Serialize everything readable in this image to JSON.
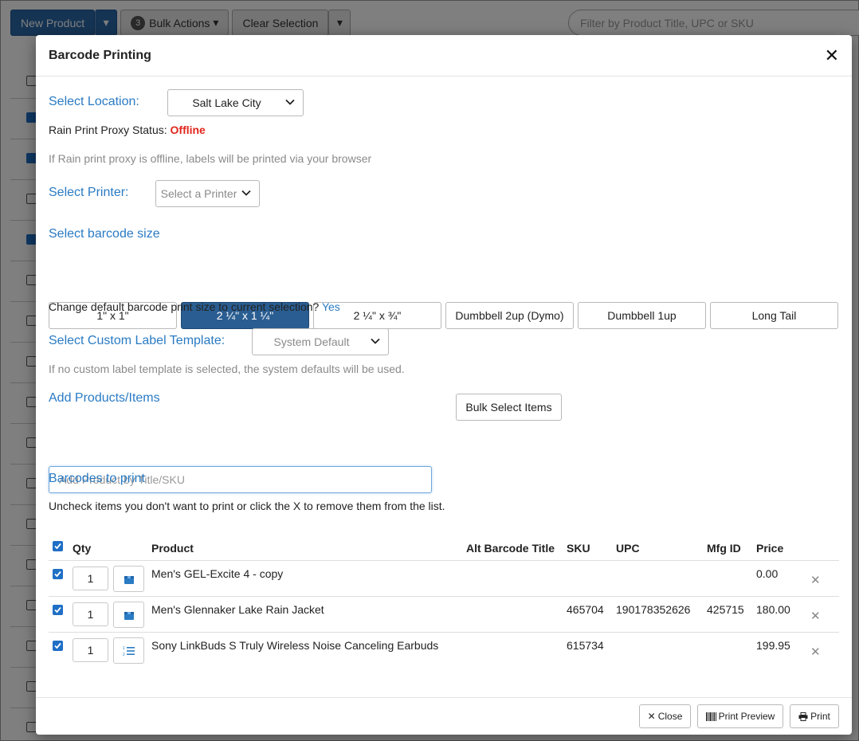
{
  "background": {
    "new_product_label": "New Product",
    "bulk_count": "3",
    "bulk_actions_label": "Bulk Actions",
    "clear_selection_label": "Clear Selection",
    "filter_placeholder": "Filter by Product Title, UPC or SKU"
  },
  "modal": {
    "title": "Barcode Printing",
    "location_label": "Select Location:",
    "location_value": "Salt Lake City",
    "proxy_status_label": "Rain Print Proxy Status:",
    "proxy_status_value": "Offline",
    "proxy_hint": "If Rain print proxy is offline, labels will be printed via your browser",
    "printer_label": "Select Printer:",
    "printer_placeholder": "Select a Printer",
    "barcode_size_label": "Select barcode size",
    "sizes": [
      "1\" x 1\"",
      "2 ¼\" x 1 ¼\"",
      "2 ¼\" x ¾\"",
      "Dumbbell 2up (Dymo)",
      "Dumbbell 1up",
      "Long Tail"
    ],
    "active_size": "2 ¼\" x 1 ¼\"",
    "change_default_text": "Change default barcode print size to current selection?",
    "change_default_link": "Yes",
    "custom_template_label": "Select Custom Label Template:",
    "custom_template_value": "System Default",
    "custom_template_hint": "If no custom label template is selected, the system defaults will be used.",
    "add_products_label": "Add Products/Items",
    "bulk_select_label": "Bulk Select Items",
    "add_product_placeholder": "Add Product by Title/SKU",
    "barcodes_to_print_label": "Barcodes to print",
    "instructions": "Uncheck items you don't want to print or click the X to remove them from the list.",
    "table": {
      "headers": {
        "qty": "Qty",
        "product": "Product",
        "alt_barcode_title": "Alt Barcode Title",
        "sku": "SKU",
        "upc": "UPC",
        "mfg_id": "Mfg ID",
        "price": "Price"
      },
      "rows": [
        {
          "qty": "1",
          "icon": "box-icon",
          "product": "Men's GEL-Excite 4 - copy",
          "sku": "",
          "upc": "",
          "mfg_id": "",
          "price": "0.00"
        },
        {
          "qty": "1",
          "icon": "box-icon",
          "product": "Men's Glennaker Lake Rain Jacket",
          "sku": "465704",
          "upc": "190178352626",
          "mfg_id": "425715",
          "price": "180.00"
        },
        {
          "qty": "1",
          "icon": "numbered-list-icon",
          "product": "Sony LinkBuds S Truly Wireless Noise Canceling Earbuds",
          "sku": "615734",
          "upc": "",
          "mfg_id": "",
          "price": "199.95"
        }
      ]
    },
    "footer": {
      "close_label": "Close",
      "print_preview_label": "Print Preview",
      "print_label": "Print"
    }
  },
  "colors": {
    "accent": "#2a7bc4",
    "active_button": "#2a5d91",
    "offline": "#e0261c",
    "checkbox": "#1f6fc5"
  }
}
